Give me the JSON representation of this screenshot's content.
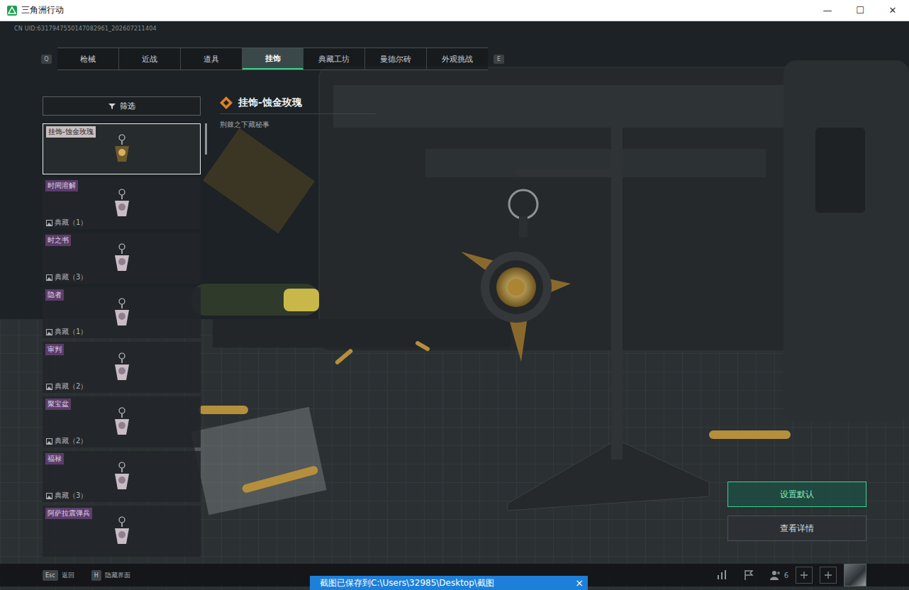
{
  "window": {
    "title": "三角洲行动",
    "controls": [
      "—",
      "☐",
      "✕"
    ]
  },
  "uid": "CN UID:6317947550147082961_202607211404",
  "tab_keys": {
    "prev": "Q",
    "next": "E"
  },
  "tabs": [
    {
      "label": "枪械",
      "selected": false
    },
    {
      "label": "近战",
      "selected": false
    },
    {
      "label": "道具",
      "selected": false
    },
    {
      "label": "挂饰",
      "selected": true
    },
    {
      "label": "典藏工坊",
      "selected": false
    },
    {
      "label": "曼德尔砖",
      "selected": false
    },
    {
      "label": "外观挑战",
      "selected": false
    }
  ],
  "filter": {
    "label": "筛选"
  },
  "items": [
    {
      "name": "挂饰-蚀金玫瑰",
      "badge": null,
      "selected": true
    },
    {
      "name": "时间溶解",
      "badge": "典藏（1）",
      "selected": false
    },
    {
      "name": "时之书",
      "badge": "典藏（3）",
      "selected": false
    },
    {
      "name": "隐者",
      "badge": "典藏（1）",
      "selected": false
    },
    {
      "name": "审判",
      "badge": "典藏（2）",
      "selected": false
    },
    {
      "name": "聚宝盆",
      "badge": "典藏（2）",
      "selected": false
    },
    {
      "name": "福禄",
      "badge": "典藏（3）",
      "selected": false
    },
    {
      "name": "阿萨拉震弹兵",
      "badge": null,
      "selected": false
    }
  ],
  "detail": {
    "title": "挂饰-蚀金玫瑰",
    "subtitle": "荆棘之下藏秘事"
  },
  "actions": [
    {
      "label": "设置默认",
      "highlighted": true
    },
    {
      "label": "查看详情",
      "highlighted": false
    }
  ],
  "hints": [
    {
      "key": "Esc",
      "label": "返回"
    },
    {
      "key": "H",
      "label": "隐藏界面"
    }
  ],
  "friends_count": "6",
  "toast": {
    "text": "截图已保存到C:\\Users\\32985\\Desktop\\截图",
    "close": "×"
  }
}
